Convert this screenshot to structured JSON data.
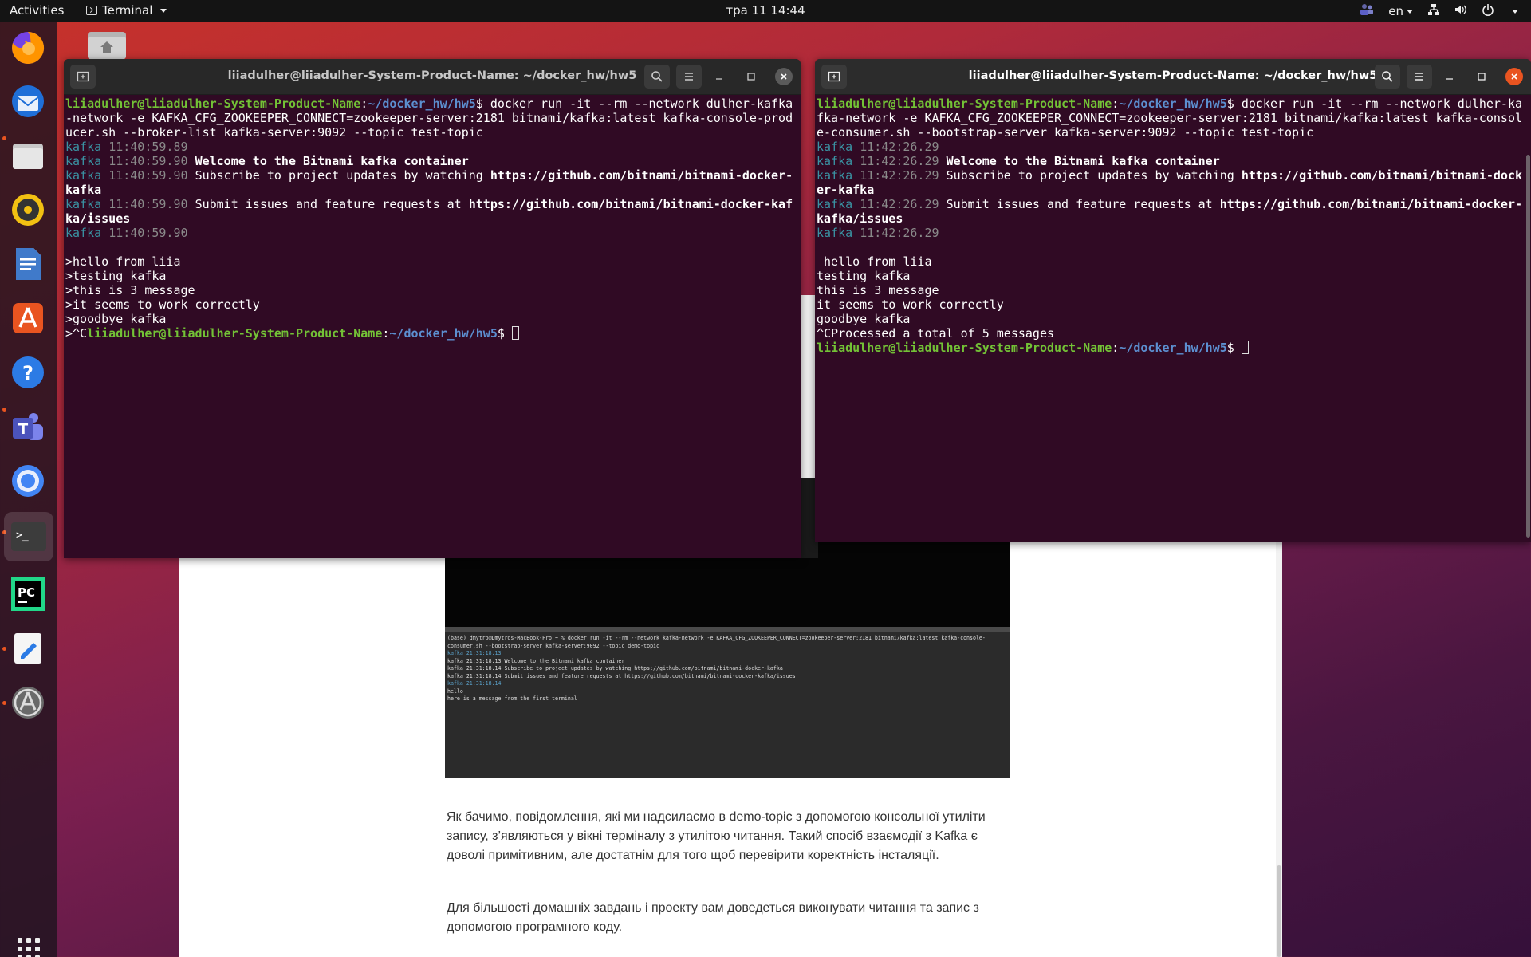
{
  "topbar": {
    "activities": "Activities",
    "app_name": "Terminal",
    "clock": "тра 11  14:44",
    "lang": "en"
  },
  "dock": {
    "items": [
      "firefox-icon",
      "thunderbird-icon",
      "files-icon",
      "rhythmbox-icon",
      "libreoffice-writer-icon",
      "app-center-icon",
      "help-icon",
      "teams-icon",
      "chromium-icon",
      "terminal-icon",
      "pycharm-icon",
      "text-editor-icon",
      "software-updater-icon"
    ]
  },
  "left_terminal": {
    "title": "liiadulher@liiadulher-System-Product-Name: ~/docker_hw/hw5",
    "prompt_user": "liiadulher@liiadulher-System-Product-Name",
    "prompt_path": "~/docker_hw/hw5",
    "command_l1": "docker run -it --rm --network dulher-kafka",
    "command_l2": "-network -e KAFKA_CFG_ZOOKEEPER_CONNECT=zookeeper-server:2181 bitnami/kafka:latest kafka-console-prod",
    "command_l3": "ucer.sh --broker-list kafka-server:9092 --topic test-topic",
    "kafka": "kafka",
    "ts1": "11:40:59.89",
    "ts2": "11:40:59.90",
    "welcome": "Welcome to the Bitnami kafka container",
    "subscribe": "Subscribe to project updates by watching ",
    "subscribe_url1": "https://github.com/bitnami/bitnami-docker-",
    "subscribe_url2": "kafka",
    "issues": "Submit issues and feature requests at ",
    "issues_url1": "https://github.com/bitnami/bitnami-docker-kaf",
    "issues_url2": "ka/issues",
    "messages": [
      ">hello from liia",
      ">testing kafka",
      ">this is 3 message",
      ">it seems to work correctly",
      ">goodbye kafka"
    ],
    "ctrl_c": ">^C"
  },
  "right_terminal": {
    "title": "liiadulher@liiadulher-System-Product-Name: ~/docker_hw/hw5",
    "prompt_user": "liiadulher@liiadulher-System-Product-Name",
    "prompt_path": "~/docker_hw/hw5",
    "command_l1": "docker run -it --rm --network dulher-ka",
    "command_l2": "fka-network -e KAFKA_CFG_ZOOKEEPER_CONNECT=zookeeper-server:2181 bitnami/kafka:latest kafka-consol",
    "command_l3": "e-consumer.sh --bootstrap-server kafka-server:9092 --topic test-topic",
    "kafka": "kafka",
    "ts": "11:42:26.29",
    "welcome": "Welcome to the Bitnami kafka container",
    "subscribe": "Subscribe to project updates by watching ",
    "subscribe_url1": "https://github.com/bitnami/bitnami-dock",
    "subscribe_url2": "er-kafka",
    "issues": "Submit issues and feature requests at ",
    "issues_url1": "https://github.com/bitnami/bitnami-docker-",
    "issues_url2": "kafka/issues",
    "messages": [
      " hello from liia",
      "testing kafka",
      "this is 3 message",
      "it seems to work correctly",
      "goodbye kafka"
    ],
    "processed": "^CProcessed a total of 5 messages"
  },
  "webpage": {
    "shot_lines": [
      "(base) dmytro@Dmytros-MacBook-Pro ~ % docker run -it --rm --network kafka-network -e KAFKA_CFG_ZOOKEEPER_CONNECT=zookeeper-server:2181 bitnami/kafka:latest kafka-console-",
      "consumer.sh --bootstrap-server kafka-server:9092 --topic demo-topic",
      "kafka 21:31:18.13",
      "kafka 21:31:18.13 Welcome to the Bitnami kafka container",
      "kafka 21:31:18.14 Subscribe to project updates by watching https://github.com/bitnami/bitnami-docker-kafka",
      "kafka 21:31:18.14 Submit issues and feature requests at https://github.com/bitnami/bitnami-docker-kafka/issues",
      "kafka 21:31:18.14",
      "",
      "hello",
      "here is a message from the first terminal"
    ],
    "para1": "Як бачимо, повідомлення, які ми надсилаємо в demo-topic з допомогою консольної утиліти запису, з’являються у вікні терміналу з утилітою читання. Такий спосіб взаємодії з Kafka є доволі примітивним, але достатнім для того щоб перевірити коректність інсталяції.",
    "para2": "Для більшості домашніх завдань і проекту вам доведеться виконувати читання та запис з допомогою програмного коду."
  },
  "colors": {
    "terminal_bg": "#300a24",
    "prompt_green": "#73c236",
    "prompt_blue": "#5c8fd0",
    "ubuntu_orange": "#e95420"
  }
}
